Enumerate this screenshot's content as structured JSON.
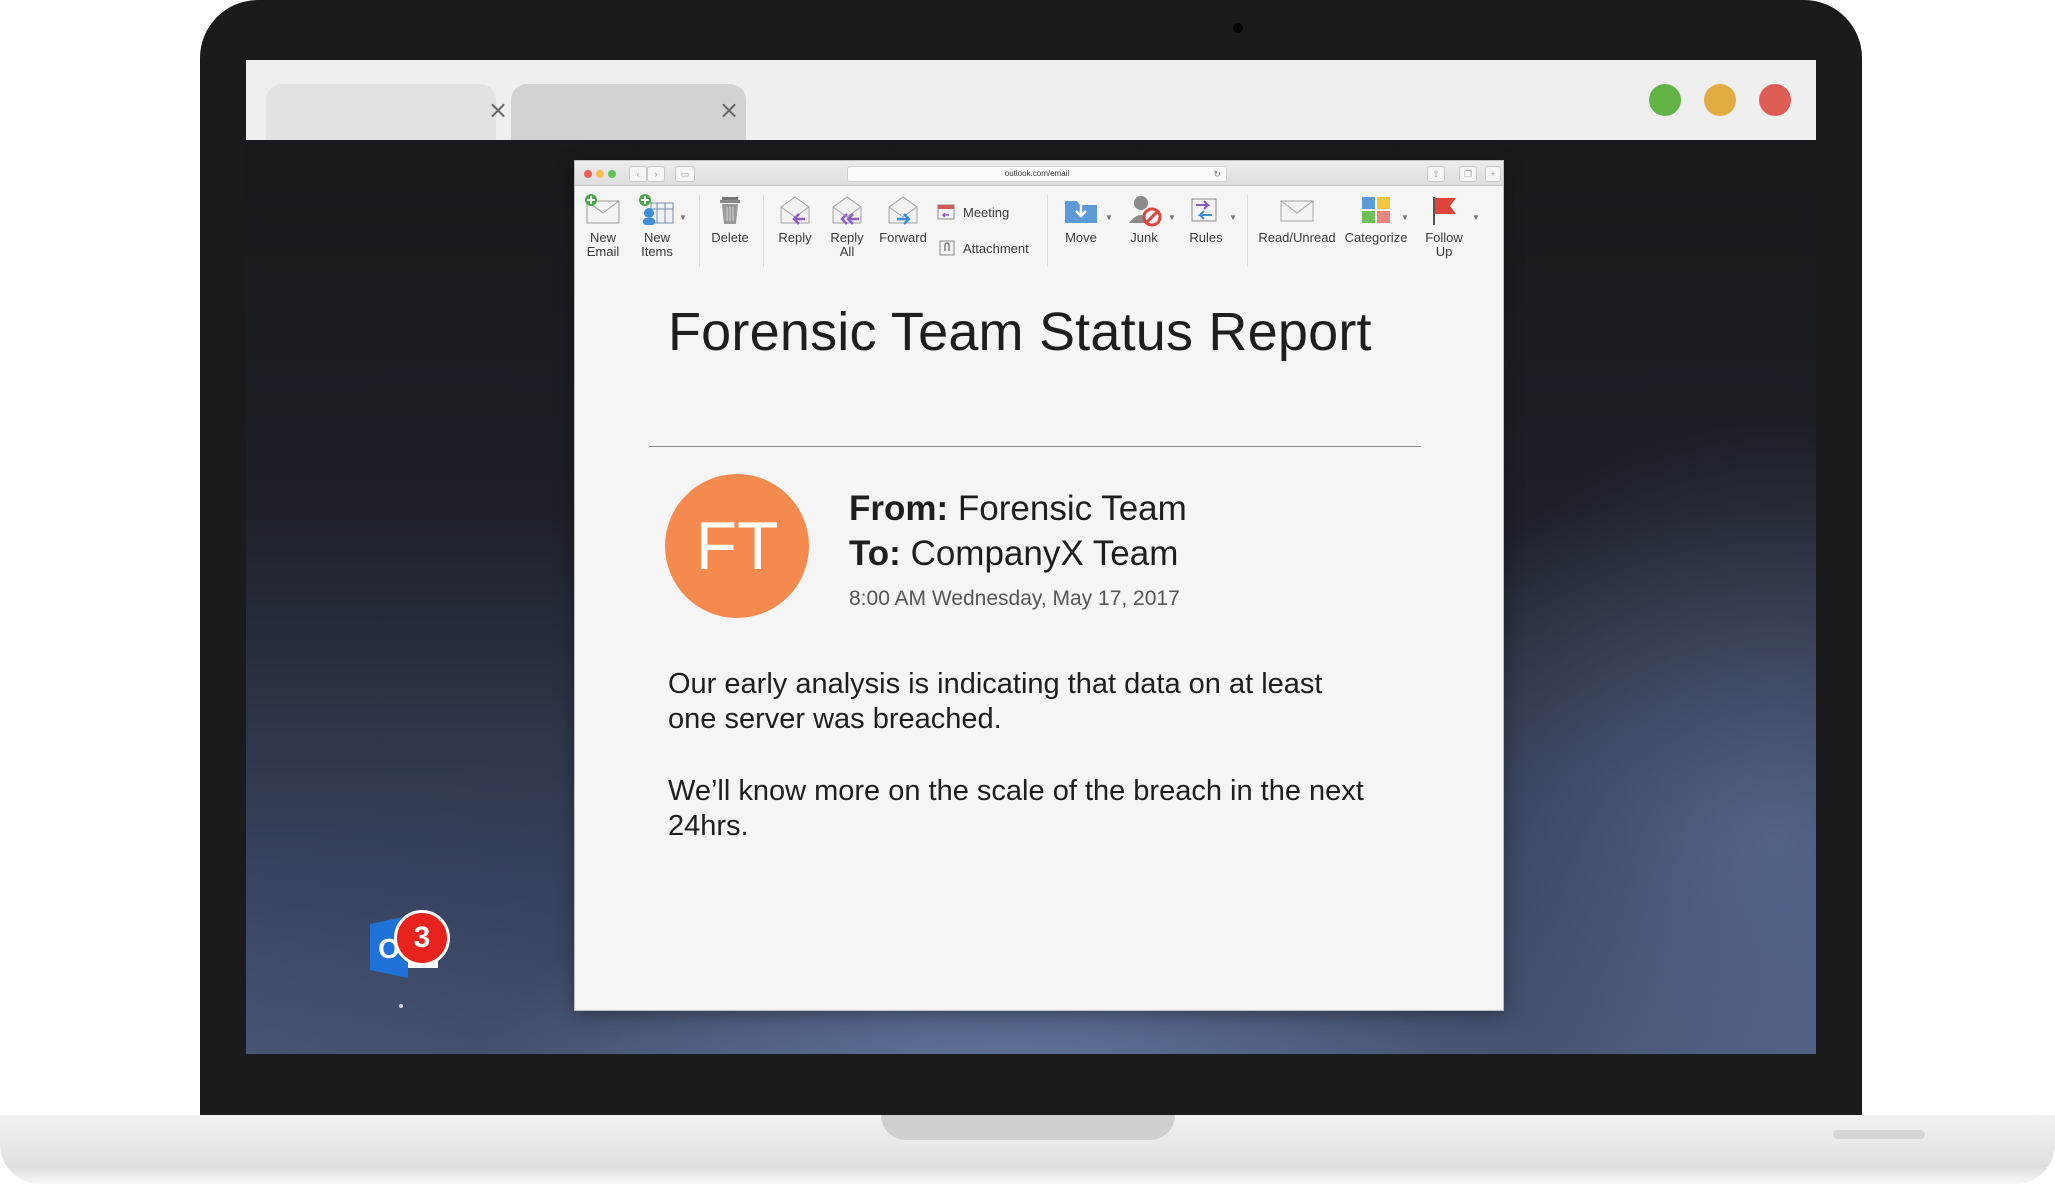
{
  "browser": {
    "tabs": [
      {
        "label": "",
        "close": "×"
      },
      {
        "label": "",
        "close": "×"
      }
    ]
  },
  "safari": {
    "url": "outlook.com/email",
    "reload": "↻"
  },
  "toolbar": {
    "new_email": [
      "New",
      "Email"
    ],
    "new_items": [
      "New",
      "Items"
    ],
    "delete": "Delete",
    "reply": "Reply",
    "reply_all": [
      "Reply",
      "All"
    ],
    "forward": "Forward",
    "meeting": "Meeting",
    "attachment": "Attachment",
    "move": "Move",
    "junk": "Junk",
    "rules": "Rules",
    "read_unread": "Read/Unread",
    "categorize": "Categorize",
    "follow_up": [
      "Follow",
      "Up"
    ]
  },
  "email": {
    "subject": "Forensic Team Status Report",
    "avatar_initials": "FT",
    "avatar_color": "#f58a4f",
    "from_label": "From:",
    "from_value": "Forensic Team",
    "to_label": "To:",
    "to_value": "CompanyX Team",
    "date": "8:00 AM Wednesday, May 17, 2017",
    "body": [
      "Our early analysis is indicating that data on at least one server was breached.",
      "We’ll know more on the scale of the breach in the next 24hrs."
    ]
  },
  "dock": {
    "app_letter": "O",
    "badge_count": "3"
  }
}
